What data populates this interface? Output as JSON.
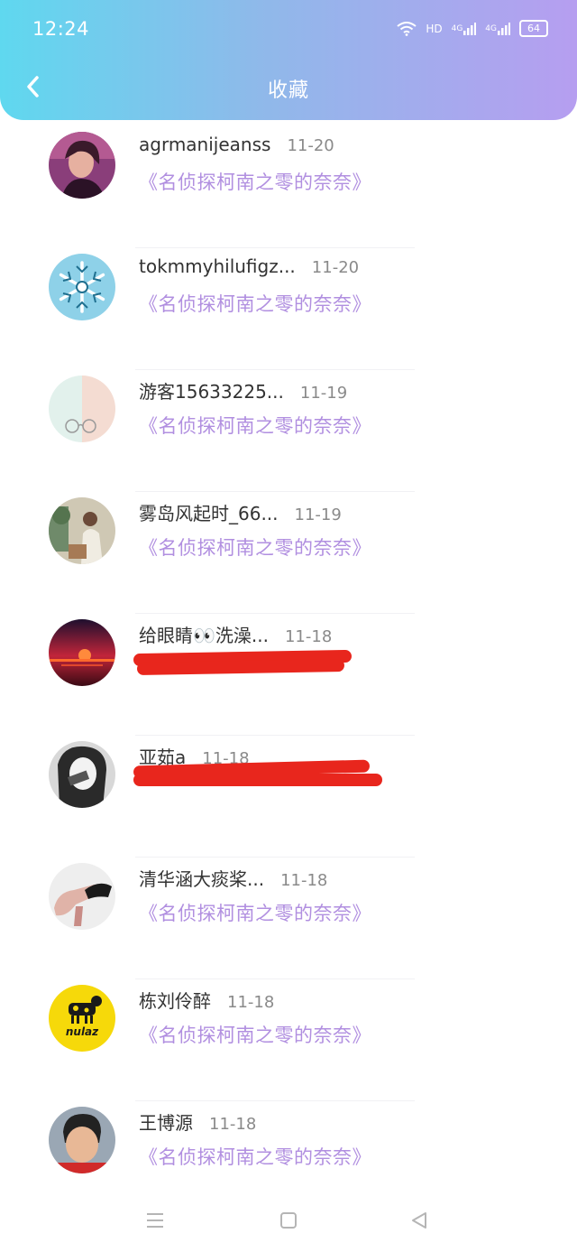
{
  "status_bar": {
    "time": "12:24",
    "network_hd": "HD",
    "sim1": "4G",
    "sim2": "4G",
    "battery": "64",
    "icons": [
      "wifi-icon",
      "signal-icon",
      "battery-icon"
    ]
  },
  "header": {
    "title": "收藏",
    "back_icon": "chevron-left-icon"
  },
  "colors": {
    "header_gradient": [
      "#5fd8ef",
      "#b69ef0"
    ],
    "work_title": "#b18fe0",
    "redaction": "#e8261d"
  },
  "favorites": [
    {
      "name": "agrmanijeanss",
      "date": "11-20",
      "work": "《名侦探柯南之零的奈奈》",
      "avatar": "portrait-photo"
    },
    {
      "name": "tokmmyhilufigz...",
      "date": "11-20",
      "work": "《名侦探柯南之零的奈奈》",
      "avatar": "snowflake-icon"
    },
    {
      "name": "游客15633225...",
      "date": "11-19",
      "work": "《名侦探柯南之零的奈奈》",
      "avatar": "glasses-photo"
    },
    {
      "name": "雾岛风起时_66...",
      "date": "11-19",
      "work": "《名侦探柯南之零的奈奈》",
      "avatar": "illustration-photo"
    },
    {
      "name": "给眼睛👀洗澡...",
      "date": "11-18",
      "work": "",
      "redacted": true,
      "avatar": "sunset-photo"
    },
    {
      "name": "亚茹a",
      "date": "11-18",
      "work": "",
      "redacted": true,
      "avatar": "portrait-photo-bw"
    },
    {
      "name": "清华涵大痰桨...",
      "date": "11-18",
      "work": "《名侦探柯南之零的奈奈》",
      "avatar": "hand-photo"
    },
    {
      "name": "栋刘伶醉",
      "date": "11-18",
      "work": "《名侦探柯南之零的奈奈》",
      "avatar": "nulaz-logo"
    },
    {
      "name": "王博源",
      "date": "11-18",
      "work": "《名侦探柯南之零的奈奈》",
      "avatar": "child-photo"
    }
  ],
  "avatar_texts": {
    "nulaz": "nulaz"
  },
  "nav": {
    "icons": [
      "menu-icon",
      "home-square-icon",
      "back-triangle-icon"
    ]
  }
}
